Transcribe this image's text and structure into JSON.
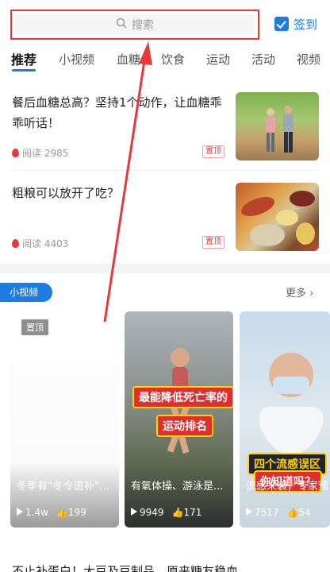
{
  "search": {
    "placeholder": "搜索"
  },
  "checkin": {
    "label": "签到"
  },
  "tabs": [
    "推荐",
    "小视频",
    "血糖",
    "饮食",
    "运动",
    "活动",
    "视频"
  ],
  "news": [
    {
      "title": "餐后血糖总高？坚持1个动作，让血糖乖乖听话！",
      "read": "阅读 2985",
      "badge": "置顶"
    },
    {
      "title": "粗粮可以放开了吃？",
      "read": "阅读 4403",
      "badge": "置顶"
    }
  ],
  "short_video": {
    "section_label": "小视频",
    "more": "更多",
    "items": [
      {
        "pin": "置顶",
        "caption": "冬季有“冬令进补”...",
        "plays": "1.4w",
        "likes": "199"
      },
      {
        "overlay_line1": "最能降低死亡率的",
        "overlay_line2": "运动排名",
        "caption": "有氧体操、游泳是...",
        "plays": "9949",
        "likes": "171"
      },
      {
        "overlay_line1": "四个流感误区",
        "overlay_line2": "你知道吗？",
        "caption": "流感来袭，专家预",
        "plays": "7517",
        "likes": "54"
      }
    ]
  },
  "bottom_item": {
    "title": "不止补蛋白！大豆及豆制品，原来糖友稳血"
  },
  "colors": {
    "accent": "#1c7ce0",
    "highlight": "#e8383d"
  }
}
